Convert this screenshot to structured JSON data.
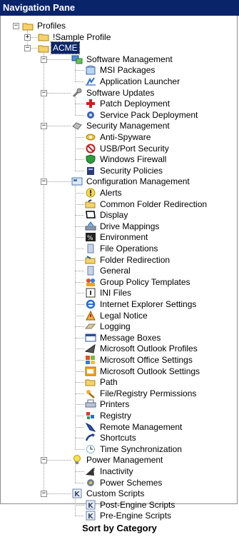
{
  "title": "Navigation Pane",
  "caption": "Sort by Category",
  "tree": [
    {
      "level": 0,
      "label": "Profiles",
      "icon": "folder-icon",
      "expander": "minus"
    },
    {
      "level": 1,
      "label": "!Sample Profile",
      "icon": "folder-icon",
      "expander": "plus"
    },
    {
      "level": 1,
      "label": "ACME",
      "icon": "folder-icon",
      "expander": "minus",
      "selected": true
    },
    {
      "level": 2,
      "label": "Software Management",
      "icon": "software-management-icon",
      "expander": "minus"
    },
    {
      "level": 3,
      "label": "MSI Packages",
      "icon": "msi-package-icon"
    },
    {
      "level": 3,
      "label": "Application Launcher",
      "icon": "application-launcher-icon"
    },
    {
      "level": 2,
      "label": "Software Updates",
      "icon": "wrench-icon",
      "expander": "minus"
    },
    {
      "level": 3,
      "label": "Patch Deployment",
      "icon": "patch-cross-icon"
    },
    {
      "level": 3,
      "label": "Service Pack Deployment",
      "icon": "service-pack-icon"
    },
    {
      "level": 2,
      "label": "Security Management",
      "icon": "security-management-icon",
      "expander": "minus"
    },
    {
      "level": 3,
      "label": "Anti-Spyware",
      "icon": "anti-spyware-icon"
    },
    {
      "level": 3,
      "label": "USB/Port Security",
      "icon": "usb-port-security-icon"
    },
    {
      "level": 3,
      "label": "Windows Firewall",
      "icon": "firewall-shield-icon"
    },
    {
      "level": 3,
      "label": "Security Policies",
      "icon": "security-policies-icon"
    },
    {
      "level": 2,
      "label": "Configuration Management",
      "icon": "configuration-management-icon",
      "expander": "minus"
    },
    {
      "level": 3,
      "label": "Alerts",
      "icon": "alert-icon"
    },
    {
      "level": 3,
      "label": "Common Folder Redirection",
      "icon": "folder-redirection-icon"
    },
    {
      "level": 3,
      "label": "Display",
      "icon": "display-icon"
    },
    {
      "level": 3,
      "label": "Drive Mappings",
      "icon": "drive-mapping-icon"
    },
    {
      "level": 3,
      "label": "Environment",
      "icon": "environment-icon"
    },
    {
      "level": 3,
      "label": "File Operations",
      "icon": "file-operations-icon"
    },
    {
      "level": 3,
      "label": "Folder Redirection",
      "icon": "folder-redirect-icon"
    },
    {
      "level": 3,
      "label": "General",
      "icon": "general-icon"
    },
    {
      "level": 3,
      "label": "Group Policy Templates",
      "icon": "group-policy-icon"
    },
    {
      "level": 3,
      "label": "INI Files",
      "icon": "ini-file-icon"
    },
    {
      "level": 3,
      "label": "Internet Explorer Settings",
      "icon": "internet-explorer-icon"
    },
    {
      "level": 3,
      "label": "Legal Notice",
      "icon": "legal-notice-icon"
    },
    {
      "level": 3,
      "label": "Logging",
      "icon": "logging-icon"
    },
    {
      "level": 3,
      "label": "Message Boxes",
      "icon": "message-box-icon"
    },
    {
      "level": 3,
      "label": "Microsoft Outlook Profiles",
      "icon": "outlook-profiles-icon"
    },
    {
      "level": 3,
      "label": "Microsoft Office Settings",
      "icon": "office-settings-icon"
    },
    {
      "level": 3,
      "label": "Microsoft Outlook Settings",
      "icon": "outlook-settings-icon"
    },
    {
      "level": 3,
      "label": "Path",
      "icon": "path-folder-icon"
    },
    {
      "level": 3,
      "label": "File/Registry Permissions",
      "icon": "permissions-icon"
    },
    {
      "level": 3,
      "label": "Printers",
      "icon": "printer-icon"
    },
    {
      "level": 3,
      "label": "Registry",
      "icon": "registry-icon"
    },
    {
      "level": 3,
      "label": "Remote Management",
      "icon": "remote-management-icon"
    },
    {
      "level": 3,
      "label": "Shortcuts",
      "icon": "shortcut-icon"
    },
    {
      "level": 3,
      "label": "Time Synchronization",
      "icon": "time-sync-icon"
    },
    {
      "level": 2,
      "label": "Power Management",
      "icon": "lightbulb-icon",
      "expander": "minus"
    },
    {
      "level": 3,
      "label": "Inactivity",
      "icon": "inactivity-icon"
    },
    {
      "level": 3,
      "label": "Power Schemes",
      "icon": "power-schemes-icon"
    },
    {
      "level": 2,
      "label": "Custom Scripts",
      "icon": "script-k-icon",
      "expander": "minus"
    },
    {
      "level": 3,
      "label": "Post-Engine Scripts",
      "icon": "script-k-icon"
    },
    {
      "level": 3,
      "label": "Pre-Engine Scripts",
      "icon": "script-k-icon"
    }
  ]
}
